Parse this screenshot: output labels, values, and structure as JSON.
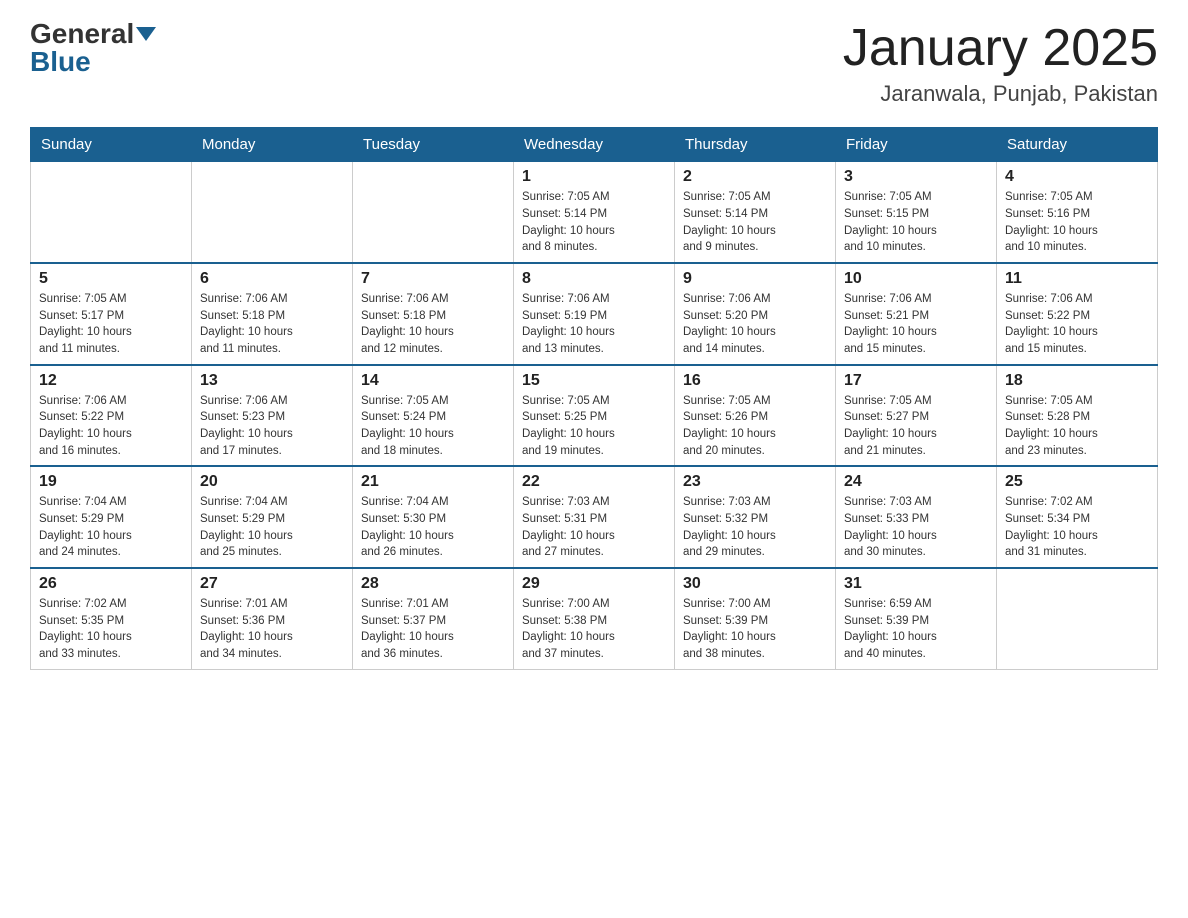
{
  "logo": {
    "general": "General",
    "blue": "Blue"
  },
  "header": {
    "month_year": "January 2025",
    "location": "Jaranwala, Punjab, Pakistan"
  },
  "weekdays": [
    "Sunday",
    "Monday",
    "Tuesday",
    "Wednesday",
    "Thursday",
    "Friday",
    "Saturday"
  ],
  "weeks": [
    [
      {
        "day": "",
        "info": ""
      },
      {
        "day": "",
        "info": ""
      },
      {
        "day": "",
        "info": ""
      },
      {
        "day": "1",
        "info": "Sunrise: 7:05 AM\nSunset: 5:14 PM\nDaylight: 10 hours\nand 8 minutes."
      },
      {
        "day": "2",
        "info": "Sunrise: 7:05 AM\nSunset: 5:14 PM\nDaylight: 10 hours\nand 9 minutes."
      },
      {
        "day": "3",
        "info": "Sunrise: 7:05 AM\nSunset: 5:15 PM\nDaylight: 10 hours\nand 10 minutes."
      },
      {
        "day": "4",
        "info": "Sunrise: 7:05 AM\nSunset: 5:16 PM\nDaylight: 10 hours\nand 10 minutes."
      }
    ],
    [
      {
        "day": "5",
        "info": "Sunrise: 7:05 AM\nSunset: 5:17 PM\nDaylight: 10 hours\nand 11 minutes."
      },
      {
        "day": "6",
        "info": "Sunrise: 7:06 AM\nSunset: 5:18 PM\nDaylight: 10 hours\nand 11 minutes."
      },
      {
        "day": "7",
        "info": "Sunrise: 7:06 AM\nSunset: 5:18 PM\nDaylight: 10 hours\nand 12 minutes."
      },
      {
        "day": "8",
        "info": "Sunrise: 7:06 AM\nSunset: 5:19 PM\nDaylight: 10 hours\nand 13 minutes."
      },
      {
        "day": "9",
        "info": "Sunrise: 7:06 AM\nSunset: 5:20 PM\nDaylight: 10 hours\nand 14 minutes."
      },
      {
        "day": "10",
        "info": "Sunrise: 7:06 AM\nSunset: 5:21 PM\nDaylight: 10 hours\nand 15 minutes."
      },
      {
        "day": "11",
        "info": "Sunrise: 7:06 AM\nSunset: 5:22 PM\nDaylight: 10 hours\nand 15 minutes."
      }
    ],
    [
      {
        "day": "12",
        "info": "Sunrise: 7:06 AM\nSunset: 5:22 PM\nDaylight: 10 hours\nand 16 minutes."
      },
      {
        "day": "13",
        "info": "Sunrise: 7:06 AM\nSunset: 5:23 PM\nDaylight: 10 hours\nand 17 minutes."
      },
      {
        "day": "14",
        "info": "Sunrise: 7:05 AM\nSunset: 5:24 PM\nDaylight: 10 hours\nand 18 minutes."
      },
      {
        "day": "15",
        "info": "Sunrise: 7:05 AM\nSunset: 5:25 PM\nDaylight: 10 hours\nand 19 minutes."
      },
      {
        "day": "16",
        "info": "Sunrise: 7:05 AM\nSunset: 5:26 PM\nDaylight: 10 hours\nand 20 minutes."
      },
      {
        "day": "17",
        "info": "Sunrise: 7:05 AM\nSunset: 5:27 PM\nDaylight: 10 hours\nand 21 minutes."
      },
      {
        "day": "18",
        "info": "Sunrise: 7:05 AM\nSunset: 5:28 PM\nDaylight: 10 hours\nand 23 minutes."
      }
    ],
    [
      {
        "day": "19",
        "info": "Sunrise: 7:04 AM\nSunset: 5:29 PM\nDaylight: 10 hours\nand 24 minutes."
      },
      {
        "day": "20",
        "info": "Sunrise: 7:04 AM\nSunset: 5:29 PM\nDaylight: 10 hours\nand 25 minutes."
      },
      {
        "day": "21",
        "info": "Sunrise: 7:04 AM\nSunset: 5:30 PM\nDaylight: 10 hours\nand 26 minutes."
      },
      {
        "day": "22",
        "info": "Sunrise: 7:03 AM\nSunset: 5:31 PM\nDaylight: 10 hours\nand 27 minutes."
      },
      {
        "day": "23",
        "info": "Sunrise: 7:03 AM\nSunset: 5:32 PM\nDaylight: 10 hours\nand 29 minutes."
      },
      {
        "day": "24",
        "info": "Sunrise: 7:03 AM\nSunset: 5:33 PM\nDaylight: 10 hours\nand 30 minutes."
      },
      {
        "day": "25",
        "info": "Sunrise: 7:02 AM\nSunset: 5:34 PM\nDaylight: 10 hours\nand 31 minutes."
      }
    ],
    [
      {
        "day": "26",
        "info": "Sunrise: 7:02 AM\nSunset: 5:35 PM\nDaylight: 10 hours\nand 33 minutes."
      },
      {
        "day": "27",
        "info": "Sunrise: 7:01 AM\nSunset: 5:36 PM\nDaylight: 10 hours\nand 34 minutes."
      },
      {
        "day": "28",
        "info": "Sunrise: 7:01 AM\nSunset: 5:37 PM\nDaylight: 10 hours\nand 36 minutes."
      },
      {
        "day": "29",
        "info": "Sunrise: 7:00 AM\nSunset: 5:38 PM\nDaylight: 10 hours\nand 37 minutes."
      },
      {
        "day": "30",
        "info": "Sunrise: 7:00 AM\nSunset: 5:39 PM\nDaylight: 10 hours\nand 38 minutes."
      },
      {
        "day": "31",
        "info": "Sunrise: 6:59 AM\nSunset: 5:39 PM\nDaylight: 10 hours\nand 40 minutes."
      },
      {
        "day": "",
        "info": ""
      }
    ]
  ]
}
